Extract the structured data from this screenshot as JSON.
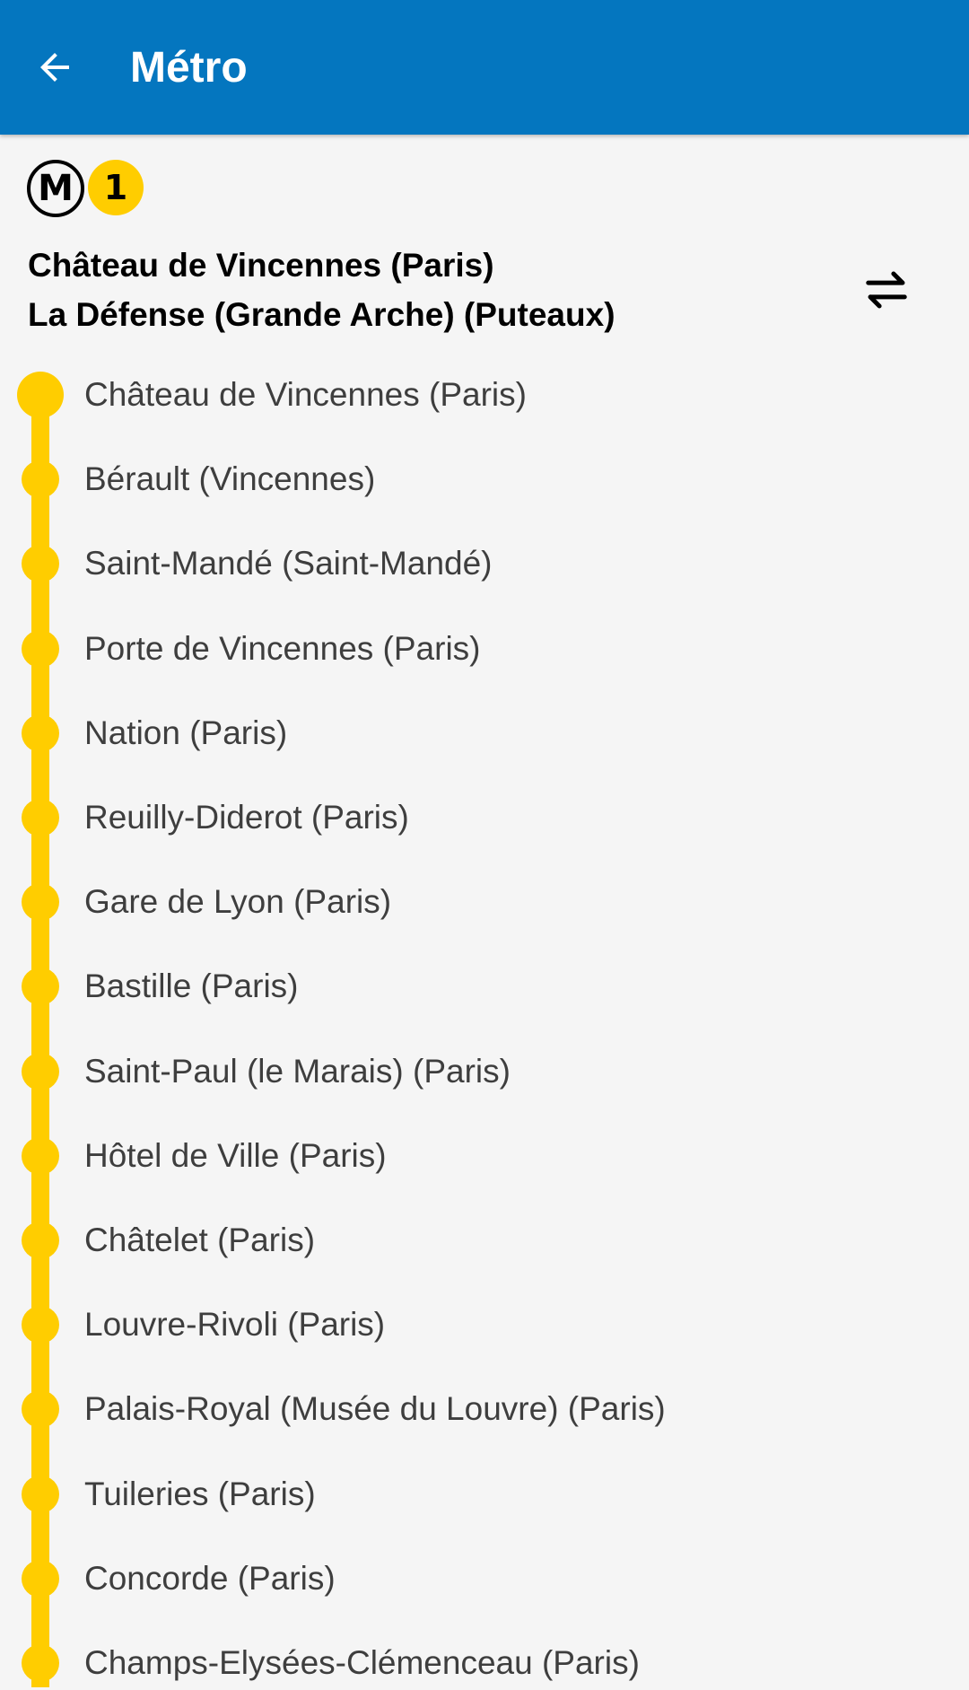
{
  "app_bar": {
    "title": "Métro",
    "background_color": "#0476BF",
    "back_icon": "arrow-left-icon"
  },
  "line": {
    "network_symbol": "M",
    "number": "1",
    "color": "#FFCD00"
  },
  "direction": {
    "from": "Château de Vincennes (Paris)",
    "to": "La Défense (Grande Arche) (Puteaux)",
    "swap_icon": "swap-direction-icon"
  },
  "stops": [
    {
      "label": "Château de Vincennes (Paris)"
    },
    {
      "label": "Bérault (Vincennes)"
    },
    {
      "label": "Saint-Mandé (Saint-Mandé)"
    },
    {
      "label": "Porte de Vincennes (Paris)"
    },
    {
      "label": "Nation (Paris)"
    },
    {
      "label": "Reuilly-Diderot (Paris)"
    },
    {
      "label": "Gare de Lyon (Paris)"
    },
    {
      "label": "Bastille (Paris)"
    },
    {
      "label": "Saint-Paul (le Marais) (Paris)"
    },
    {
      "label": "Hôtel de Ville (Paris)"
    },
    {
      "label": "Châtelet (Paris)"
    },
    {
      "label": "Louvre-Rivoli (Paris)"
    },
    {
      "label": "Palais-Royal (Musée du Louvre) (Paris)"
    },
    {
      "label": "Tuileries (Paris)"
    },
    {
      "label": "Concorde (Paris)"
    },
    {
      "label": "Champs-Elysées-Clémenceau (Paris)"
    }
  ]
}
